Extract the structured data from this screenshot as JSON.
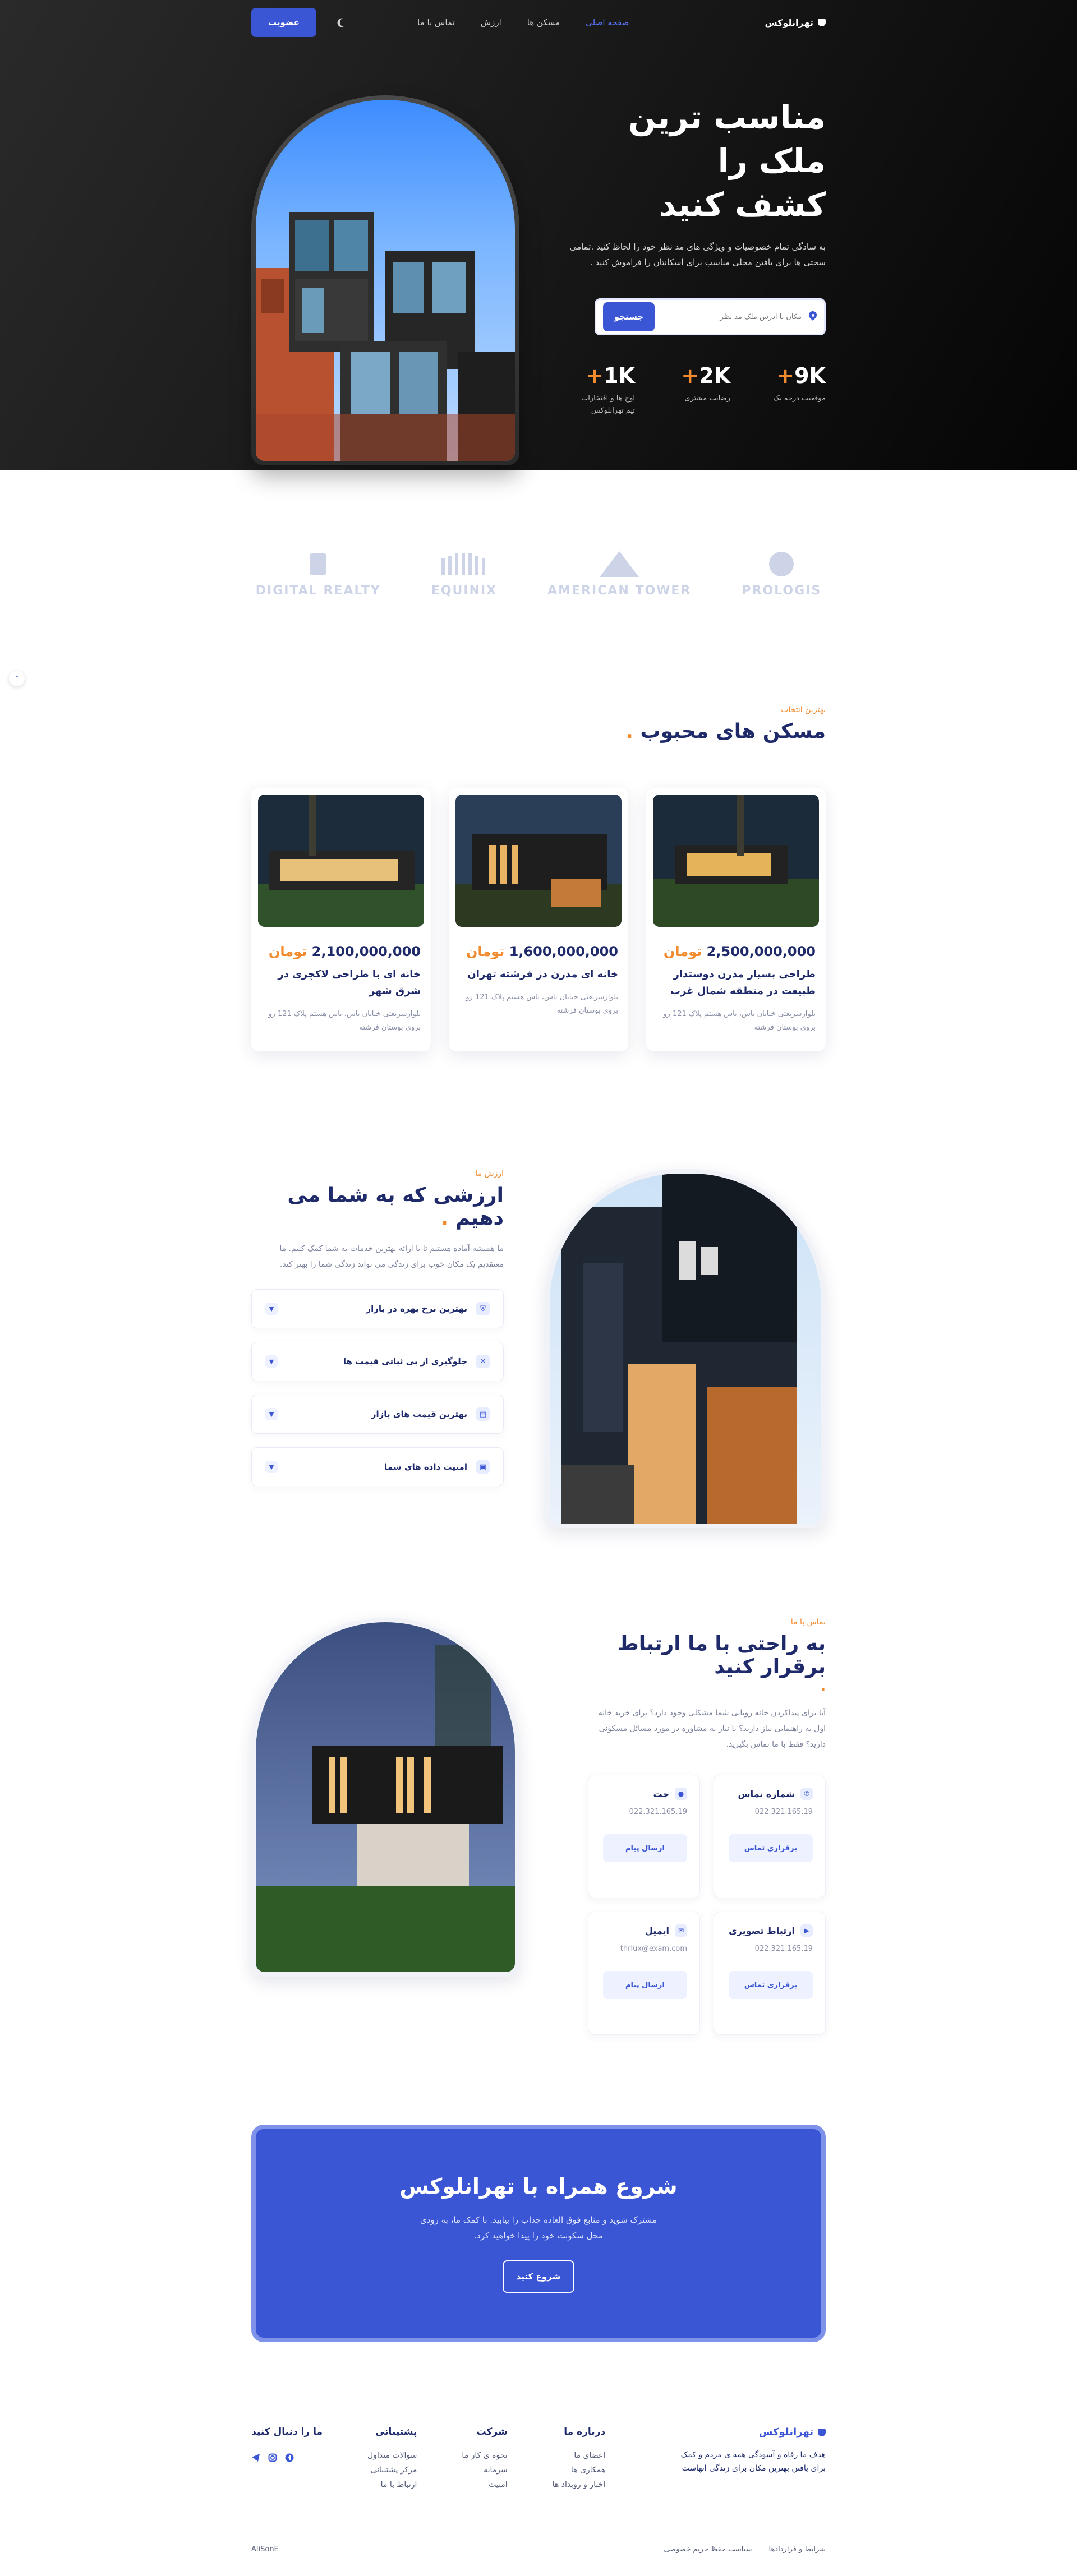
{
  "nav": {
    "brand": "تهرانلوکس",
    "links": [
      "صفحه اصلی",
      "مسکن ها",
      "ارزش",
      "تماس با ما"
    ],
    "signup": "عضویت"
  },
  "hero": {
    "title_lines": [
      "مناسب ترین",
      "ملک را",
      "کشف کنید"
    ],
    "description": "به سادگی تمام خصوصیات و ویژگی های مد نظر خود را لحاظ کنید .تمامی سختی ها برای یافتن محلی مناسب برای اسکانتان را فراموش کنید .",
    "search_placeholder": "مکان یا آدرس ملک مد نظر",
    "search_button": "جستجو",
    "stats": [
      {
        "num": "9K",
        "label": "موقعیت درجه یک"
      },
      {
        "num": "2K",
        "label": "رضایت مشتری"
      },
      {
        "num": "1K",
        "label": "اوج ها و افتخارات تیم تهرانلوکس"
      }
    ]
  },
  "logos": [
    "DIGITAL REALTY",
    "EQUINIX",
    "AMERICAN TOWER",
    "PROLOGIS"
  ],
  "popular": {
    "eyebrow": "بهترین انتخاب",
    "title": "مسکن های محبوب",
    "currency": "تومان",
    "cards": [
      {
        "price": "2,500,000,000",
        "title": "طراحی بسیار مدرن دوستدار طبیعت در منطقه شمال غرب",
        "address": "بلوارشریعتی خیابان یاس، یاس هشتم پلاک 121 رو بروی بوستان فرشته"
      },
      {
        "price": "1,600,000,000",
        "title": "خانه ای مدرن در فرشته تهران",
        "address": "بلوارشریعتی خیابان یاس، یاس هشتم پلاک 121 رو بروی بوستان فرشته"
      },
      {
        "price": "2,100,000,000",
        "title": "خانه ای با طراحی لاکچری در شرق شهر",
        "address": "بلوارشریعتی خیابان یاس، یاس هشتم پلاک 121 رو بروی بوستان فرشته"
      }
    ]
  },
  "value": {
    "eyebrow": "ارزش ما",
    "title": "ارزشی که به شما می دهیم",
    "description": "ما همیشه آماده هستیم تا با ارائه بهترین خدمات به شما کمک کنیم. ما معتقدیم یک مکان خوب برای زندگی می تواند زندگی شما را بهتر کند.",
    "items": [
      "بهترین نرخ بهره در بازار",
      "جلوگیری از بی ثباتی قیمت ها",
      "بهترین قیمت های بازار",
      "امنیت داده های شما"
    ]
  },
  "contact": {
    "eyebrow": "تماس با ما",
    "title": "به راحتی با ما ارتباط برقرار کنید",
    "description": "آیا برای پیداکردن خانه رویایی شما مشکلی وجود دارد؟ برای خرید خانه اول به راهنمایی نیاز دارید؟ یا نیاز به مشاوره در مورد مسائل مسکونی دارید؟ فقط با ما تماس بگیرید.",
    "cards": [
      {
        "title": "شماره تماس",
        "value": "022.321.165.19",
        "button": "برقراری تماس"
      },
      {
        "title": "چت",
        "value": "022.321.165.19",
        "button": "ارسال پیام"
      },
      {
        "title": "ارتباط تصویری",
        "value": "022.321.165.19",
        "button": "برقراری تماس"
      },
      {
        "title": "ایمیل",
        "value": "thrlux@exam.com",
        "button": "ارسال پیام"
      }
    ]
  },
  "cta": {
    "title": "شروع همراه با تهرانلوکس",
    "description": "مشترک شوید و منابع فوق العاده جذاب را بیابید. با کمک ما، به زودی محل سکونت خود را پیدا خواهید کرد.",
    "button": "شروع کنید"
  },
  "footer": {
    "brand": "تهرانلوکس",
    "description": "هدف ما رفاه و آسودگی همه ی مردم و کمک برای یافتن بهترین مکان برای زندگی انهاست",
    "columns": [
      {
        "title": "درباره ما",
        "links": [
          "اعضای ما",
          "همکاری ها",
          "اخبار و رویداد ها"
        ]
      },
      {
        "title": "شرکت",
        "links": [
          "نحوه ی کار ما",
          "سرمایه",
          "امنیت"
        ]
      },
      {
        "title": "پشتیبانی",
        "links": [
          "سوالات متداول",
          "مرکز پشتیبانی",
          "ارتباط با ما"
        ]
      },
      {
        "title": "ما را دنبال کنید",
        "links": []
      }
    ],
    "legal": [
      "شرایط و قراردادها",
      "سیاست حفظ حریم خصوصی"
    ],
    "credit": "AliSonE"
  }
}
